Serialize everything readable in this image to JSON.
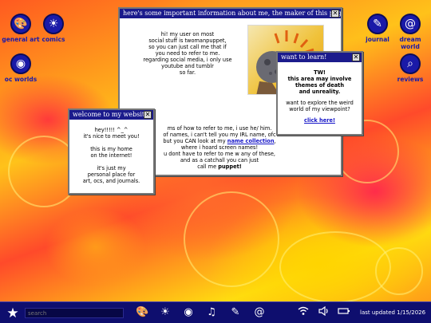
{
  "desktop": {
    "left_icons": [
      {
        "label": "general art",
        "icon": "palette-icon"
      },
      {
        "label": "comics",
        "icon": "sun-icon"
      },
      {
        "label": "oc worlds",
        "icon": "globe-icon"
      }
    ],
    "right_icons": [
      {
        "label": "journal",
        "icon": "notebook-icon"
      },
      {
        "label": "dream world",
        "icon": "swirl-icon"
      },
      {
        "label": "reviews",
        "icon": "magnifier-icon"
      }
    ]
  },
  "about_window": {
    "title": "here's some important information about me, the maker of this page!",
    "intro": [
      "hi! my user on most",
      "social stuff is twomanpuppet,",
      "so you can just call me that if",
      "you need to refer to me.",
      "regarding social media, i only use",
      "youtube and tumblr",
      "so far."
    ],
    "lower_lines": [
      "ms of how to refer to me, i use he/ him.",
      "of names, i can't tell you my IRL name, ofc",
      "but you CAN look at my"
    ],
    "link_text": "name collection",
    "after_link": ",",
    "lower_lines_2": [
      "where i hoard screen names!",
      "u dont have to refer to me w any of these,",
      "and as a catchall you can just",
      "call me"
    ],
    "puppet_word": "puppet!"
  },
  "welcome_window": {
    "title": "welcome to my website!",
    "lines": [
      "hey!!!!! ^_^",
      "it's nice to meet you!",
      "",
      "this is my home",
      "on the internet!",
      "",
      "it's just my",
      "personal place for",
      "art, ocs, and journals."
    ]
  },
  "learn_window": {
    "title": "want to learn!",
    "tw_lines": [
      "TW!",
      "this area may involve",
      "themes of death",
      "and unreality."
    ],
    "question_lines": [
      "want to explore the weird",
      "world of my viewpoint?"
    ],
    "link": "click here!"
  },
  "taskbar": {
    "search_placeholder": "search",
    "last_updated": "last updated 1/15/2026",
    "tray_icons": [
      "wifi-icon",
      "volume-icon",
      "battery-icon"
    ],
    "app_icons": [
      "palette-icon",
      "sun-icon",
      "globe-icon",
      "drum-icon",
      "notebook-icon",
      "swirl-icon"
    ]
  },
  "colors": {
    "taskbar": "#0e0e6e",
    "titlebar": "#1b1b8c",
    "link": "#1515c8",
    "icon_blue": "#1a1aa8"
  }
}
